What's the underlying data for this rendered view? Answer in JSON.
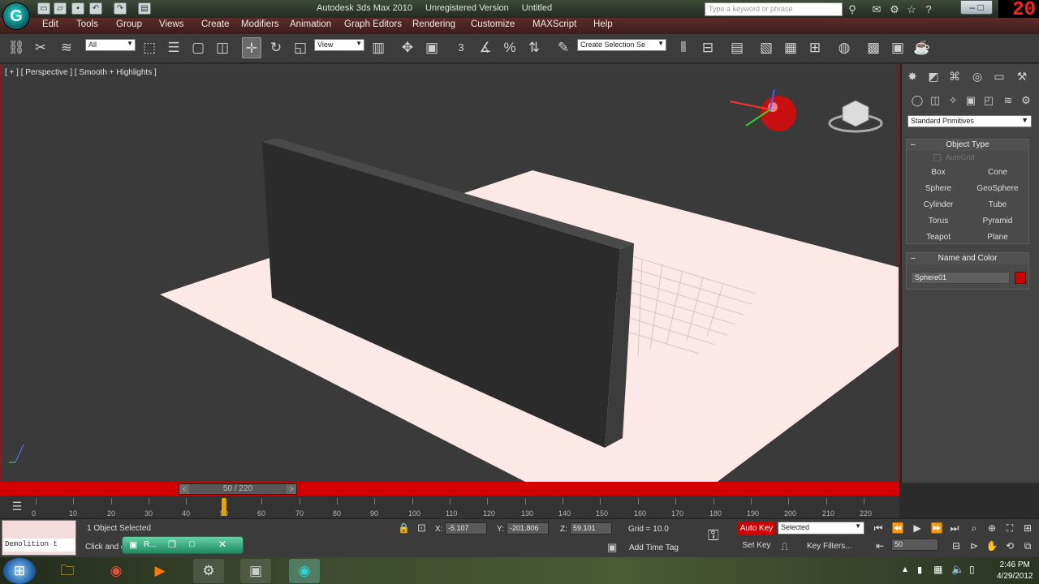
{
  "app": {
    "logo_glyph": "G",
    "title": "Autodesk 3ds Max 2010",
    "edition": "Unregistered Version",
    "document": "Untitled",
    "search_placeholder": "Type a keyword or phrase",
    "recording_counter": "20",
    "window_controls": "– □"
  },
  "menu": [
    "Edit",
    "Tools",
    "Group",
    "Views",
    "Create",
    "Modifiers",
    "Animation",
    "Graph Editors",
    "Rendering",
    "Customize",
    "MAXScript",
    "Help"
  ],
  "toolbar": {
    "filter_value": "All",
    "reference_coord": "View",
    "selection_set": "Create Selection Se",
    "snap_label": "3"
  },
  "viewport": {
    "label": "[ + ] [ Perspective ] [ Smooth + Highlights ]",
    "background": "#3a3a3a",
    "ground_color": "#fce8e6",
    "wall_color": "#2b2b2b"
  },
  "command_panel": {
    "category_dropdown": "Standard Primitives",
    "object_type_title": "Object Type",
    "autogrid_label": "AutoGrid",
    "primitives": [
      "Box",
      "Cone",
      "Sphere",
      "GeoSphere",
      "Cylinder",
      "Tube",
      "Torus",
      "Pyramid",
      "Teapot",
      "Plane"
    ],
    "name_color_title": "Name and Color",
    "object_name": "Sphere01",
    "object_color": "#d10000",
    "collapse_glyph": "–"
  },
  "timeline": {
    "slider_label": "50 / 220",
    "current_frame": 50,
    "total_frames": 220,
    "prev_glyph": "<",
    "next_glyph": ">",
    "ticks": [
      "0",
      "10",
      "20",
      "30",
      "40",
      "50",
      "60",
      "70",
      "80",
      "90",
      "100",
      "110",
      "120",
      "130",
      "140",
      "150",
      "160",
      "170",
      "180",
      "190",
      "200",
      "210",
      "220"
    ]
  },
  "status": {
    "maxscript_listener": "",
    "maxscript_line": "Demolition t",
    "selection_info": "1 Object Selected",
    "prompt": "Click and d",
    "taskbar_popup_label": "R...",
    "x_label": "X:",
    "x_value": "-5.107",
    "y_label": "Y:",
    "y_value": "-201.806",
    "z_label": "Z:",
    "z_value": "59.101",
    "grid": "Grid = 10.0",
    "add_time_tag": "Add Time Tag",
    "auto_key": "Auto Key",
    "set_key": "Set Key",
    "key_mode": "Selected",
    "key_filters": "Key Filters...",
    "frame_field": "50"
  },
  "taskbar": {
    "time": "2:46 PM",
    "date": "4/29/2012"
  }
}
